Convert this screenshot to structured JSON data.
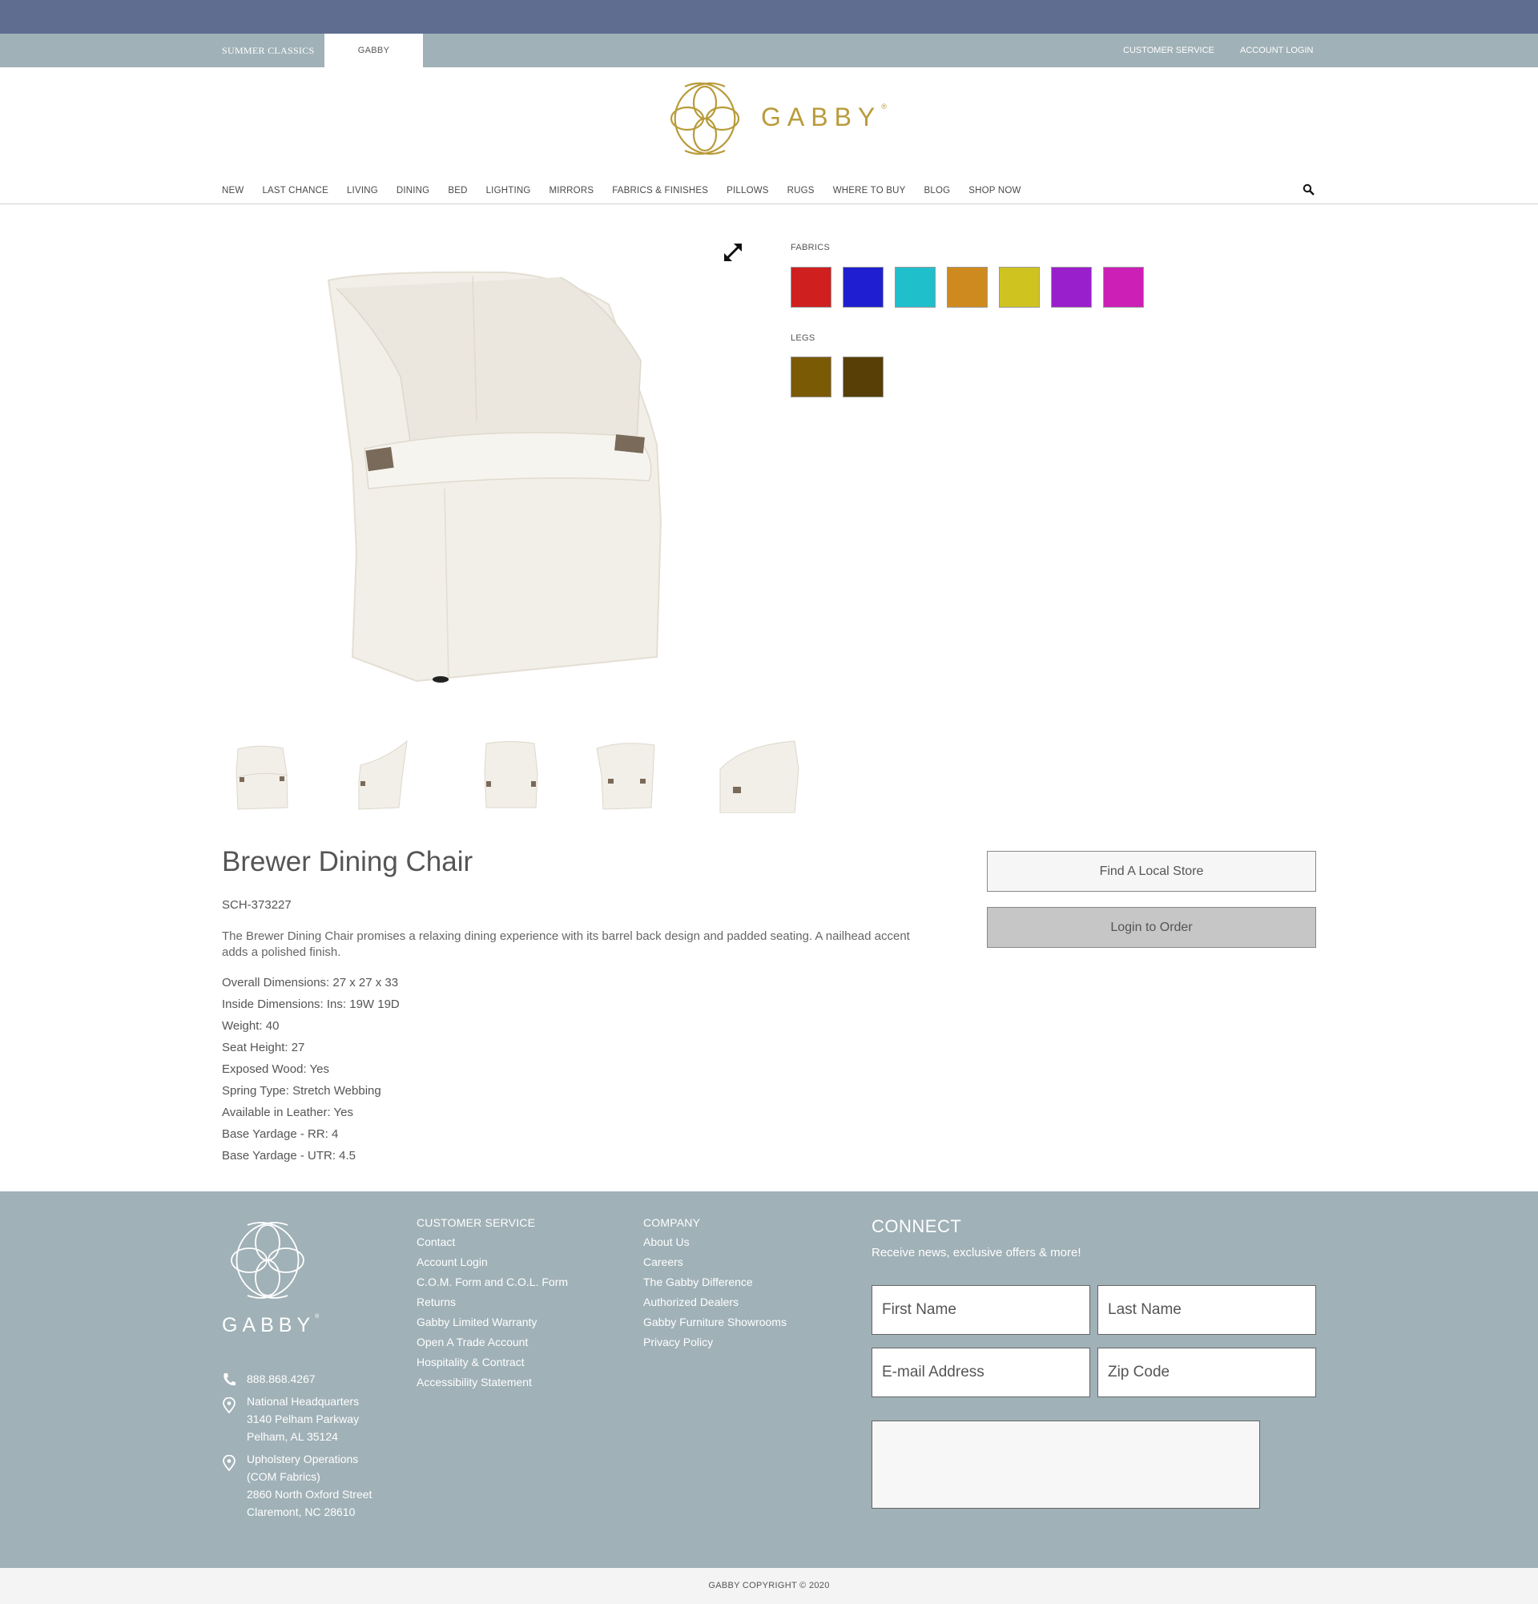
{
  "brand_bar": {
    "tab_summer": "SUMMER CLASSICS",
    "tab_gabby": "GABBY",
    "customer_service": "CUSTOMER SERVICE",
    "account_login": "ACCOUNT LOGIN"
  },
  "logo": {
    "text": "GABBY"
  },
  "nav": {
    "items": [
      "NEW",
      "LAST CHANCE",
      "LIVING",
      "DINING",
      "BED",
      "LIGHTING",
      "MIRRORS",
      "FABRICS & FINISHES",
      "PILLOWS",
      "RUGS",
      "WHERE TO BUY",
      "BLOG",
      "SHOP NOW"
    ]
  },
  "options": {
    "fabrics_label": "FABRICS",
    "fabrics": [
      "#cf1f1f",
      "#1f1fd1",
      "#1fbfcc",
      "#cf8a1f",
      "#cfc41f",
      "#9a1fcc",
      "#cc1fb5"
    ],
    "legs_label": "LEGS",
    "legs": [
      "#7b5a05",
      "#573f05"
    ]
  },
  "product": {
    "title": "Brewer Dining Chair",
    "sku": "SCH-373227",
    "description": "The Brewer Dining Chair promises a relaxing dining experience with its barrel back design and padded seating. A nailhead accent adds a polished finish.",
    "specs": [
      "Overall Dimensions: 27 x 27 x 33",
      "Inside Dimensions: Ins: 19W 19D",
      "Weight: 40",
      "Seat Height: 27",
      "Exposed Wood: Yes",
      "Spring Type: Stretch Webbing",
      "Available in Leather: Yes",
      "Base Yardage - RR: 4",
      "Base Yardage - UTR: 4.5"
    ],
    "find_store": "Find A Local Store",
    "login_order": "Login to Order"
  },
  "footer": {
    "logo_text": "GABBY",
    "phone": "888.868.4267",
    "hq": [
      "National Headquarters",
      "3140 Pelham Parkway",
      "Pelham, AL 35124"
    ],
    "upholstery": [
      "Upholstery Operations",
      "(COM Fabrics)",
      "2860 North Oxford Street",
      "Claremont, NC 28610"
    ],
    "cs_title": "CUSTOMER SERVICE",
    "cs_links": [
      "Contact",
      "Account Login",
      "C.O.M. Form and C.O.L. Form",
      "Returns",
      "Gabby Limited Warranty",
      "Open A Trade Account",
      "Hospitality & Contract",
      "Accessibility Statement"
    ],
    "company_title": "COMPANY",
    "company_links": [
      "About Us",
      "Careers",
      "The Gabby Difference",
      "Authorized Dealers",
      "Gabby Furniture Showrooms",
      "Privacy Policy"
    ],
    "connect_title": "CONNECT",
    "connect_sub": "Receive news, exclusive offers & more!",
    "first_name": "First Name",
    "last_name": "Last Name",
    "email": "E-mail Address",
    "zip": "Zip Code"
  },
  "copyright": "GABBY COPYRIGHT © 2020"
}
